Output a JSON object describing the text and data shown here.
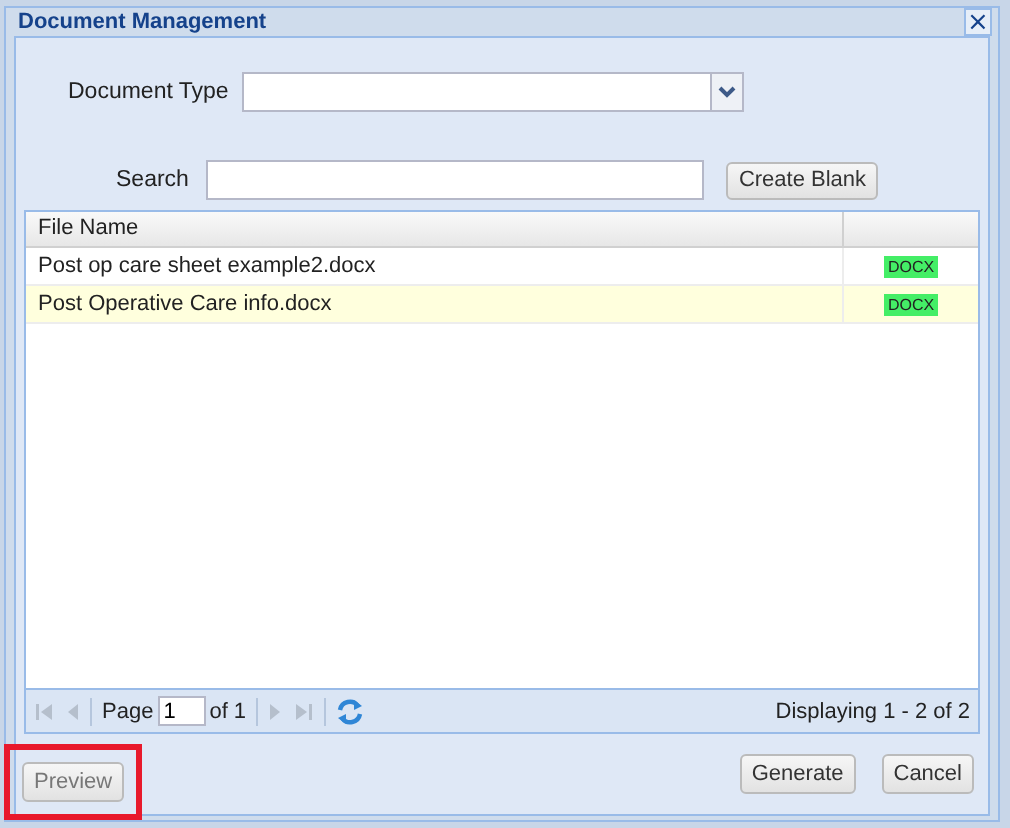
{
  "window": {
    "title": "Document Management",
    "close": "×"
  },
  "document_type": {
    "label": "Document Type"
  },
  "search": {
    "label": "Search"
  },
  "create_blank_button": "Create Blank",
  "table": {
    "columns": [
      "File Name"
    ],
    "rows": [
      {
        "file_name": "Post op care sheet example2.docx",
        "type": "DOCX",
        "selected": false
      },
      {
        "file_name": "Post Operative Care info.docx",
        "type": "DOCX",
        "selected": true
      }
    ]
  },
  "pager": {
    "page_label": "Page",
    "page": "1",
    "of": "of 1",
    "status": "Displaying 1 - 2 of 2"
  },
  "buttons": [
    {
      "label": "Preview",
      "highlighted": true
    },
    {
      "label": "Generate",
      "highlighted": false
    },
    {
      "label": "Cancel",
      "highlighted": false
    }
  ]
}
